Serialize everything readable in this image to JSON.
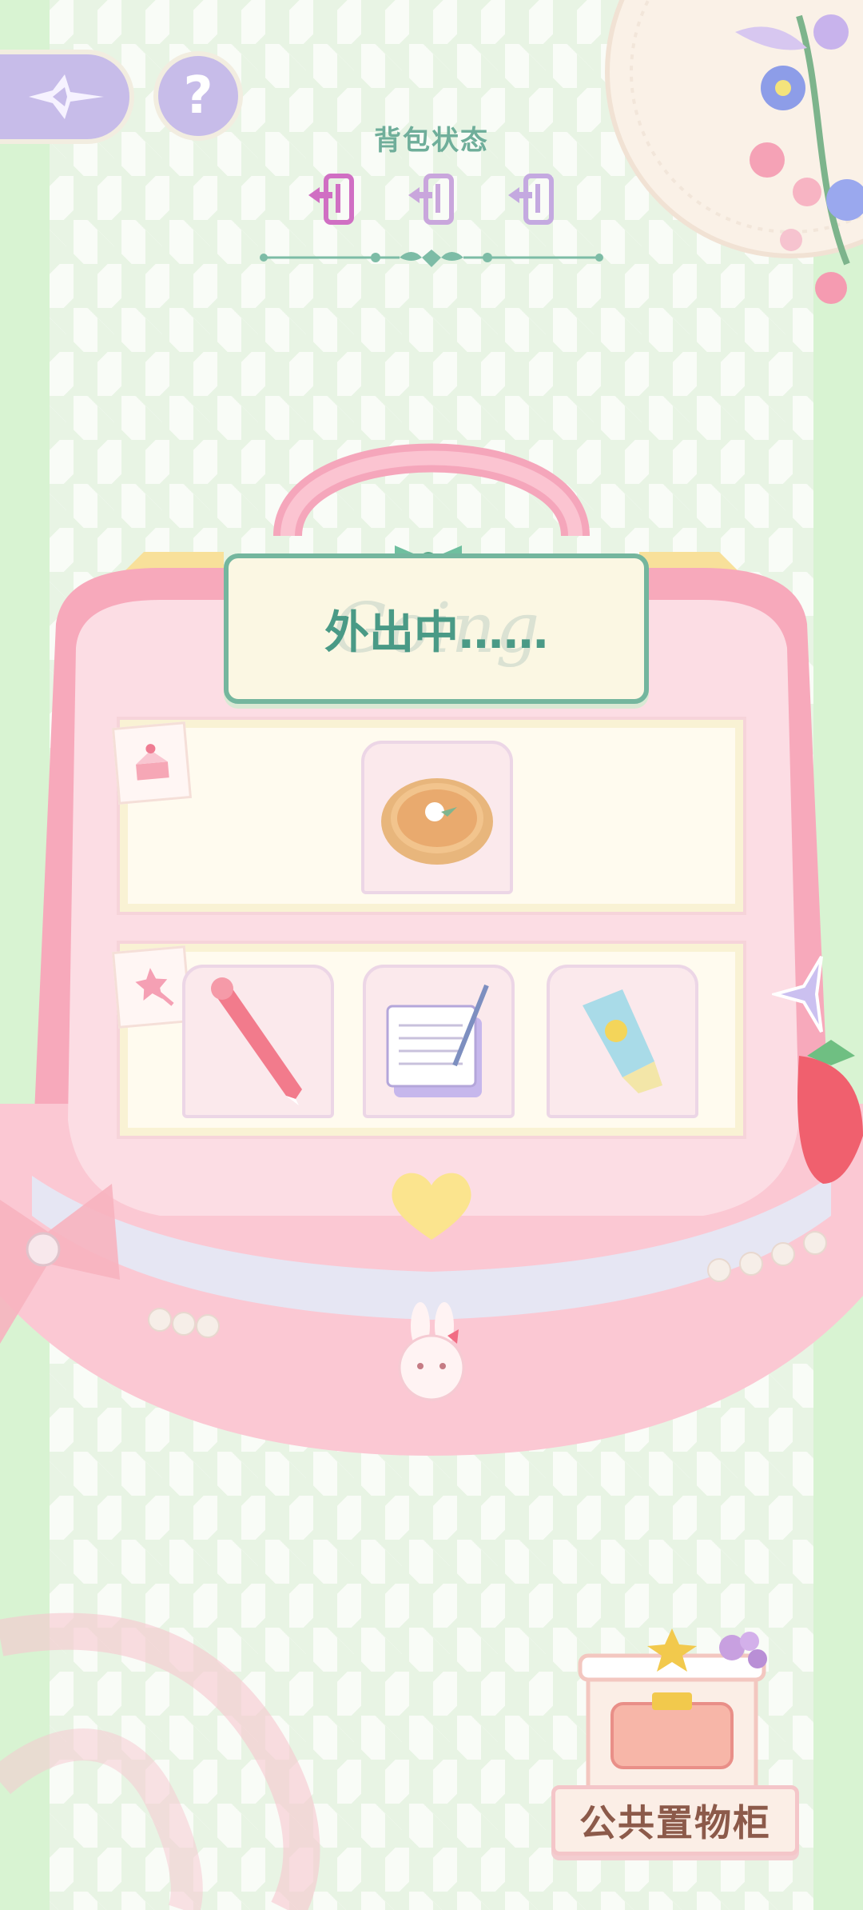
{
  "header": {
    "title": "背包状态",
    "state_icons": [
      "exit-door-icon-active",
      "exit-door-icon",
      "exit-door-icon"
    ]
  },
  "controls": {
    "back_icon": "sparkle-star-icon",
    "help_label": "?"
  },
  "bag": {
    "status_text": "外出中……",
    "status_bg_text": "Going"
  },
  "shelves": [
    {
      "tag_icon": "cake-icon",
      "items": [
        "pie-item"
      ]
    },
    {
      "tag_icon": "wand-icon",
      "items": [
        "pen-item",
        "notebook-item",
        "lotion-tube-item"
      ]
    }
  ],
  "cabinet": {
    "label": "公共置物柜"
  },
  "colors": {
    "accent_green": "#6fae9a",
    "button_purple": "#c7bce9",
    "bag_pink": "#f7a9bb"
  }
}
